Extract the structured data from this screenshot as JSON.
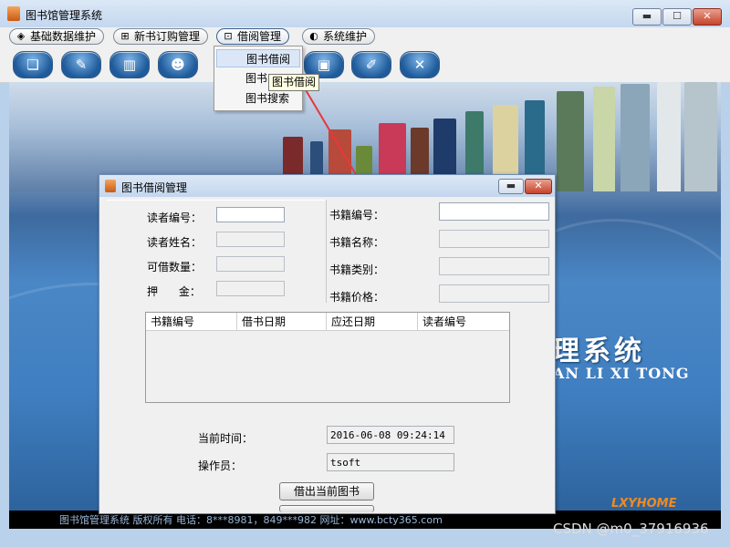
{
  "window": {
    "title": "图书馆管理系统",
    "icon": "java-cup-icon",
    "controls": [
      "minimize",
      "maximize",
      "close"
    ]
  },
  "menu": [
    {
      "label": "基础数据维护",
      "icon": "cube-icon"
    },
    {
      "label": "新书订购管理",
      "icon": "cart-icon"
    },
    {
      "label": "借阅管理",
      "icon": "lock-icon"
    },
    {
      "label": "系统维护",
      "icon": "gear-icon"
    }
  ],
  "toolbar_icons": [
    "book-open-icon",
    "pen-icon",
    "books-icon",
    "reader-icon",
    "hidden",
    "hidden",
    "monitor-icon",
    "card-icon",
    "exit-icon"
  ],
  "dropdown": {
    "items": [
      {
        "label": "图书借阅"
      },
      {
        "label": "图书"
      },
      {
        "label": "图书搜索"
      }
    ],
    "tooltip": "图书借阅"
  },
  "background": {
    "title_fragment": "理系统",
    "subtitle_fragment": "AN LI XI TONG",
    "footer": "图书馆管理系统   版权所有    电话：8***8981，849***982    网址：www.bcty365.com",
    "logo": "LXYHOME"
  },
  "dialog": {
    "title": "图书借阅管理",
    "reader": {
      "id_label": "读者编号：",
      "name_label": "读者姓名：",
      "quota_label": "可借数量：",
      "deposit_label": "押      金："
    },
    "book": {
      "id_label": "书籍编号：",
      "name_label": "书籍名称：",
      "type_label": "书籍类别：",
      "price_label": "书籍价格："
    },
    "table_headers": [
      "书籍编号",
      "借书日期",
      "应还日期",
      "读者编号"
    ],
    "current_time_label": "当前时间：",
    "current_time_value": "2016-06-08 09:24:14",
    "operator_label": "操作员：",
    "operator_value": "tsoft",
    "borrow_button": "借出当前图书"
  },
  "watermark": "CSDN @m0_37916936",
  "colors": {
    "arrow": "#e8373a",
    "accent": "#3a6ea8"
  }
}
